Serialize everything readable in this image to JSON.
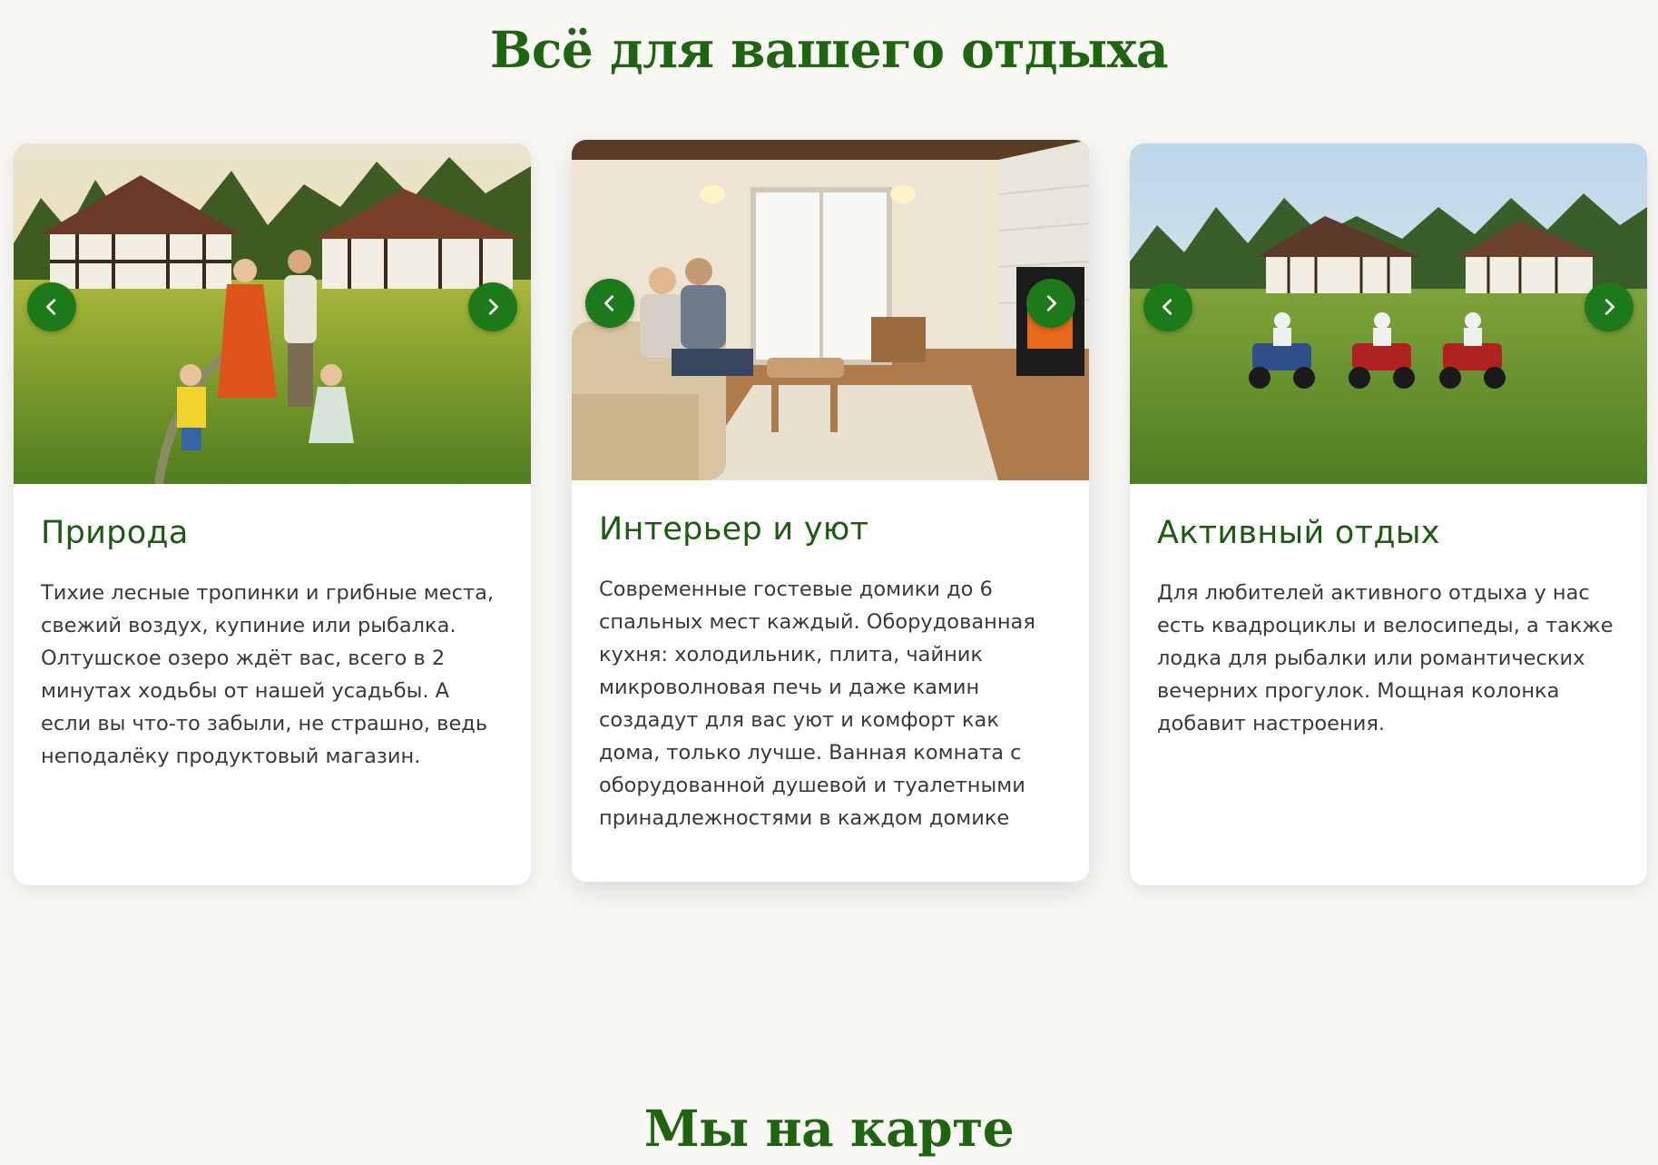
{
  "section_title": "Всё для вашего отдыха",
  "cards": [
    {
      "title": "Природа",
      "text": "Тихие лесные тропинки и грибные места, свежий воздух, купиние или рыбалка. Олтушское озеро ждёт вас, всего в 2 минутах ходьбы от нашей усадьбы. А если вы что-то забыли, не страшно, ведь неподалёку продуктовый магазин.",
      "image": "family-walking-meadow-photo"
    },
    {
      "title": "Интерьер и уют",
      "text": "Современные гостевые домики до 6 спальных мест каждый. Оборудованная кухня: холодильник, плита, чайник микроволновая печь и даже камин создадут для вас уют и комфорт как дома, только лучше. Ванная комната с оборудованной душевой и туалетными принадлежностями в каждом домике",
      "image": "living-room-fireplace-photo"
    },
    {
      "title": "Активный отдых",
      "text": "Для любителей активного отдыха у нас есть квадроциклы и велосипеды, а также лодка для рыбалки или романтических вечерних прогулок. Мощная колонка добавит настроения.",
      "image": "quad-bikes-meadow-photo"
    }
  ],
  "carousel_icons": {
    "prev": "chevron-left-icon",
    "next": "chevron-right-icon"
  },
  "next_section_title": "Мы на карте",
  "colors": {
    "title_green": "#1f6410",
    "card_title_green": "#1f5a12",
    "nav_button_green": "#1d7a1a",
    "page_background": "#f9f7f4"
  }
}
